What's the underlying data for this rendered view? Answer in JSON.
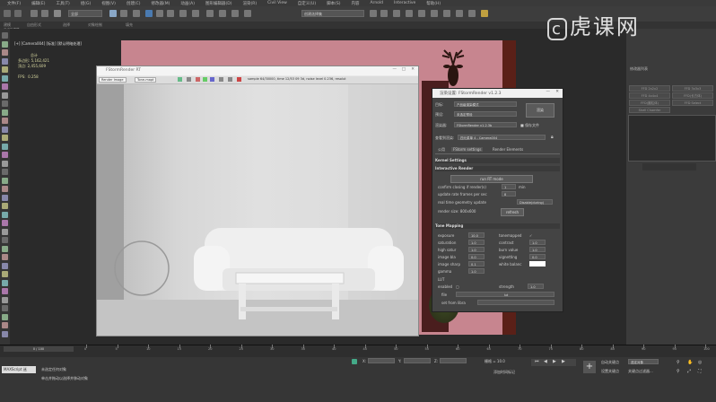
{
  "menu": {
    "items": [
      "文件(F)",
      "编辑(E)",
      "工具(T)",
      "组(G)",
      "视图(V)",
      "创建(C)",
      "修改器(M)",
      "动画(A)",
      "图形编辑器(D)",
      "渲染(R)",
      "Civil View",
      "自定义(U)",
      "脚本(S)",
      "内容",
      "Arnold",
      "Interactive",
      "帮助(H)"
    ]
  },
  "toolbar": {
    "selection_filter": "全部",
    "named_selection": "创建选择集"
  },
  "tabs": [
    "建模",
    "自由形式",
    "选择",
    "对象绘制",
    "填充"
  ],
  "ribbon_sub": "多边形建模",
  "viewport": {
    "label": "[+] [Camera004] [标准] [默认明暗处理]",
    "stats": {
      "total_label": "总计",
      "polys_label": "多边形:",
      "polys": "5,162,421",
      "verts_label": "顶点:",
      "verts": "2,455,609",
      "fps_label": "FPS:",
      "fps": "0.258"
    }
  },
  "render_window": {
    "title": "FStormRender RT",
    "tool_items": [
      "Render Image",
      "Tone-mapt"
    ],
    "status": {
      "samples": "sample 64/30000,",
      "time": "time 12/53 09 3d,",
      "noise": "noise level 0.236,",
      "resolution": "resolut"
    }
  },
  "settings": {
    "title": "渲染设置: FStormRender v1.2.3",
    "target_label": "目标:",
    "target_value": "产品级渲染模式",
    "preset_label": "预设:",
    "preset_value": "未选定预设",
    "renderer_label": "渲染器:",
    "renderer_value": "FStormRender v1.2.3b",
    "save_file_label": "保存文件",
    "view_label": "查看到渲染:",
    "view_value": "四元菜单 4 - Camera004",
    "render_button": "渲染",
    "tabs": [
      "公用",
      "FStorm settings",
      "Render Elements"
    ],
    "kernel_section": "Kernel Settings",
    "interactive_section": "Interactive Render",
    "run_rt_button": "run RT mode",
    "confirm_label": "confirm closing if render(s)",
    "confirm_value": "1",
    "confirm_unit": "min",
    "update_rate_label": "update rate frames per sec",
    "update_rate_value": "8",
    "realtime_label": "real time geometry update",
    "realtime_value": "Disable(during)",
    "render_size_label": "render size: 800x600",
    "refresh_button": "refresh",
    "tone_section": "Tone Mapping",
    "tone_rows": [
      {
        "left_label": "exposure",
        "left_value": "10.0",
        "right_label": "tonemapped",
        "right_value": "✓"
      },
      {
        "left_label": "saturation",
        "left_value": "1.0",
        "right_label": "contrast",
        "right_value": "1.0"
      },
      {
        "left_label": "high satur",
        "left_value": "1.0",
        "right_label": "burn value",
        "right_value": "1.0"
      },
      {
        "left_label": "image bla",
        "left_value": "0.0",
        "right_label": "vignetting",
        "right_value": "0.0"
      },
      {
        "left_label": "image sharp",
        "left_value": "0.1",
        "right_label": "white balanc",
        "right_value": ""
      },
      {
        "left_label": "gamma",
        "left_value": "1.0",
        "right_label": "",
        "right_value": ""
      }
    ],
    "lut_label": "LUT",
    "lut_enabled_label": "enabled",
    "lut_strength_label": "strength",
    "lut_strength_value": "1.0",
    "lut_file_label": "file",
    "lut_file_value": "lut",
    "lut_library_label": "set from libra"
  },
  "right_panel": {
    "modifier_list": "修改器列表",
    "buttons": [
      "FFD 2x2x2",
      "FFD 3x3x3",
      "FFD 4x4x4",
      "FFD(长方体)",
      "FFD(圆柱体)",
      "FFD Select",
      "Shell Chamfer"
    ]
  },
  "timeline": {
    "frame_counter": "0 / 100",
    "ticks": [
      "0",
      "5",
      "10",
      "15",
      "20",
      "25",
      "30",
      "35",
      "40",
      "45",
      "50",
      "55",
      "60",
      "65",
      "70",
      "75",
      "80",
      "85",
      "90",
      "95",
      "100"
    ]
  },
  "status": {
    "script_label": "MAXScript 迷",
    "line1": "未选定任何对象",
    "line2": "单击并拖动以选择并移动对象",
    "x_label": "X:",
    "y_label": "Y:",
    "z_label": "Z:",
    "grid_label": "栅格 = 10.0",
    "add_time_tag": "添加时间标记",
    "autokey": "自动关键点",
    "setkey": "设置关键点",
    "selected": "选定对象",
    "key_filters": "关键点过滤器..."
  },
  "watermark": "虎课网",
  "colors": {
    "wall": "#c7858f",
    "accent": "#e3c44a",
    "panel": "#444444"
  }
}
